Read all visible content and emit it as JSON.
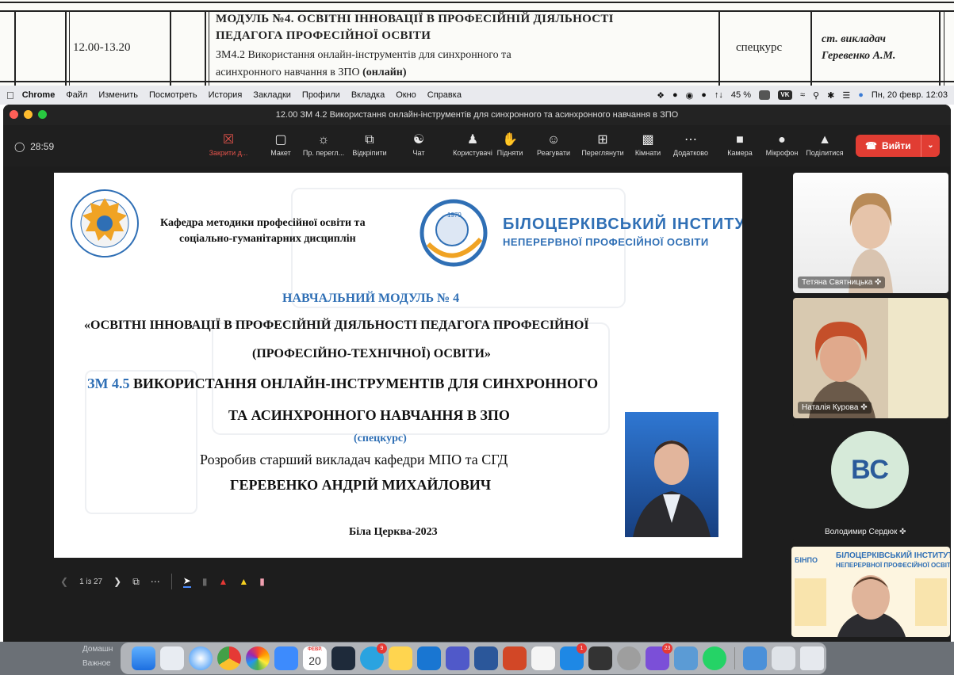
{
  "schedule": {
    "time": "12.00-13.20",
    "module_title_line1": "МОДУЛЬ №4. ОСВІТНІ ІННОВАЦІЇ В ПРОФЕСІЙНІЙ ДІЯЛЬНОСТІ",
    "module_title_line2": "ПЕДАГОГА ПРОФЕСІЙНОЇ ОСВІТИ",
    "submodule_line1": "ЗМ4.2 Використання онлайн-інструментів для синхронного та",
    "submodule_line2": "асинхронного навчання в ЗПО",
    "submodule_mode": "(онлайн)",
    "type": "спецкурс",
    "teacher_line1": "ст. викладач",
    "teacher_line2": "Геревенко А.М."
  },
  "menubar": {
    "app": "Chrome",
    "items": [
      "Файл",
      "Изменить",
      "Посмотреть",
      "История",
      "Закладки",
      "Профили",
      "Вкладка",
      "Окно",
      "Справка"
    ],
    "battery": "45 %",
    "datetime": "Пн, 20 февр. 12:03",
    "vk": "VK"
  },
  "zoom": {
    "window_title": "12.00 ЗМ 4.2 Використання онлайн-інструментів для синхронного та асинхронного навчання в ЗПО",
    "timer": "28:59",
    "toolbar": [
      {
        "label": "Закрити д...",
        "icon": "close-share-icon"
      },
      {
        "label": "Макет",
        "icon": "layout-icon"
      },
      {
        "label": "Пр. перегл...",
        "icon": "preview-icon"
      },
      {
        "label": "Відкріпити",
        "icon": "unpin-icon"
      },
      {
        "label": "Чат",
        "icon": "chat-icon"
      },
      {
        "label": "Користувачі",
        "icon": "users-icon"
      },
      {
        "label": "Підняти",
        "icon": "raise-hand-icon"
      },
      {
        "label": "Реагувати",
        "icon": "react-icon"
      },
      {
        "label": "Переглянути",
        "icon": "view-icon"
      },
      {
        "label": "Кімнати",
        "icon": "rooms-icon"
      },
      {
        "label": "Додатково",
        "icon": "more-icon"
      },
      {
        "label": "Камера",
        "icon": "camera-icon"
      },
      {
        "label": "Мікрофон",
        "icon": "mic-icon"
      },
      {
        "label": "Поділитися",
        "icon": "share-icon"
      }
    ],
    "leave_label": "Вийти",
    "page_counter": "1 із 27"
  },
  "slide": {
    "dept_line1": "Кафедра методики професійної освіти та",
    "dept_line2": "соціально-гуманітарних дисциплін",
    "inst_line1": "БІЛОЦЕРКІВСЬКИЙ ІНСТИТУТ",
    "inst_line2": "НЕПЕРЕРВНОЇ ПРОФЕСІЙНОЇ ОСВІТИ",
    "logo_year": "1979",
    "module_heading": "НАВЧАЛЬНИЙ МОДУЛЬ № 4",
    "module_name_line1": "«ОСВІТНІ ІННОВАЦІЇ В ПРОФЕСІЙНІЙ ДІЯЛЬНОСТІ ПЕДАГОГА ПРОФЕСІЙНОЇ",
    "module_name_line2": "(ПРОФЕСІЙНО-ТЕХНІЧНОЇ) ОСВІТИ»",
    "zm_code": "ЗМ 4.5",
    "zm_line1": "ВИКОРИСТАННЯ ОНЛАЙН-ІНСТРУМЕНТІВ ДЛЯ СИНХРОННОГО",
    "zm_line2": "ТА АСИНХРОННОГО НАВЧАННЯ В ЗПО",
    "course_type": "(спецкурс)",
    "author_intro": "Розробив старший викладач кафедри МПО та СГД",
    "author_name": "ГЕРЕВЕНКО АНДРІЙ МИХАЙЛОВИЧ",
    "city_year": "Біла Церква-2023"
  },
  "participants": [
    {
      "name": "Тетяна Святницька"
    },
    {
      "name": "Наталія Курова"
    },
    {
      "name": "Володимир Сердюк",
      "initials": "ВС"
    }
  ],
  "self_view": {
    "bg_title_line1": "БІЛОЦЕРКІВСЬКИЙ ІНСТИТУТ",
    "bg_title_line2": "НЕПЕРЕРВНОЇ ПРОФЕСІЙНОЇ ОСВІТИ",
    "bg_logo": "БІНПО"
  },
  "dock": {
    "finder_labels": [
      "Домашн",
      "Важное"
    ],
    "calendar_month": "ФЕВР.",
    "calendar_day": "20",
    "badges": {
      "telegram": "9",
      "appstore": "1",
      "viber": "23"
    }
  },
  "colors": {
    "accent_blue": "#2f6fb5",
    "leave_red": "#e13d33",
    "zoom_bg": "#1d1d1d"
  }
}
